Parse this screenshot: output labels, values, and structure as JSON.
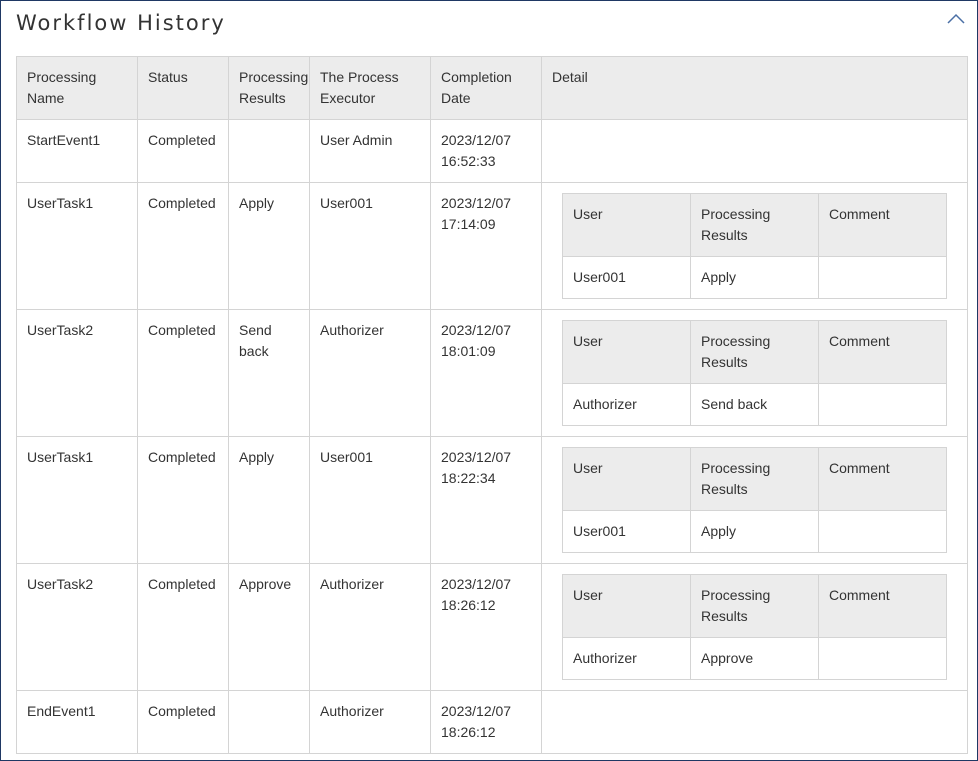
{
  "panel": {
    "title": "Workflow History",
    "collapse_icon": "chevron-up-icon"
  },
  "columns": [
    "Processing Name",
    "Status",
    "Processing Results",
    "The Process Executor",
    "Completion Date",
    "Detail"
  ],
  "detail_columns": [
    "User",
    "Processing Results",
    "Comment"
  ],
  "rows": [
    {
      "name": "StartEvent1",
      "status": "Completed",
      "result": "",
      "executor": "User Admin",
      "date": "2023/12/07",
      "time": "16:52:33",
      "detail": null
    },
    {
      "name": "UserTask1",
      "status": "Completed",
      "result": "Apply",
      "executor": "User001",
      "date": "2023/12/07",
      "time": "17:14:09",
      "detail": {
        "user": "User001",
        "result": "Apply",
        "comment": ""
      }
    },
    {
      "name": "UserTask2",
      "status": "Completed",
      "result": "Send back",
      "executor": "Authorizer",
      "date": "2023/12/07",
      "time": "18:01:09",
      "detail": {
        "user": "Authorizer",
        "result": "Send back",
        "comment": ""
      }
    },
    {
      "name": "UserTask1",
      "status": "Completed",
      "result": "Apply",
      "executor": "User001",
      "date": "2023/12/07",
      "time": "18:22:34",
      "detail": {
        "user": "User001",
        "result": "Apply",
        "comment": ""
      }
    },
    {
      "name": "UserTask2",
      "status": "Completed",
      "result": "Approve",
      "executor": "Authorizer",
      "date": "2023/12/07",
      "time": "18:26:12",
      "detail": {
        "user": "Authorizer",
        "result": "Approve",
        "comment": ""
      }
    },
    {
      "name": "EndEvent1",
      "status": "Completed",
      "result": "",
      "executor": "Authorizer",
      "date": "2023/12/07",
      "time": "18:26:12",
      "detail": null
    }
  ],
  "colors": {
    "border": "#1f3864",
    "header_bg": "#ececec",
    "grid": "#d4d4d4",
    "icon": "#4a6fa5"
  }
}
